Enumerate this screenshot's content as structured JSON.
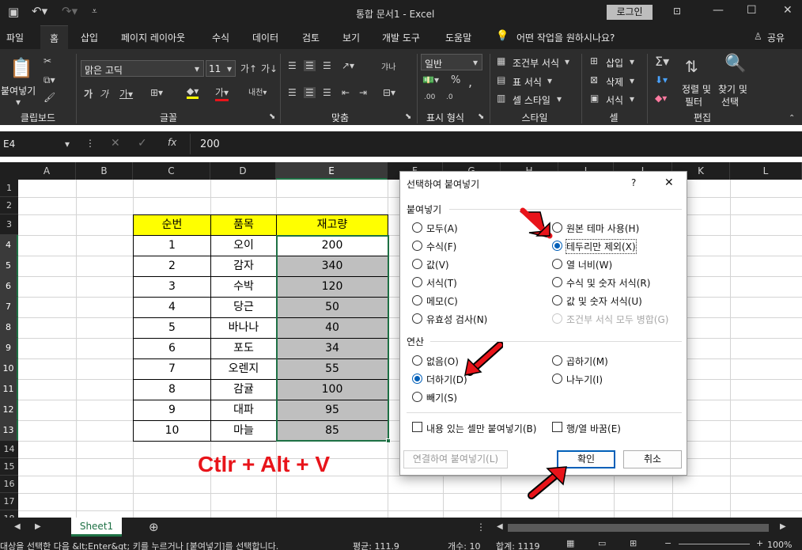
{
  "title": "통합 문서1  -  Excel",
  "login": "로그인",
  "tabs": [
    "파일",
    "홈",
    "삽입",
    "페이지 레이아웃",
    "수식",
    "데이터",
    "검토",
    "보기",
    "개발 도구",
    "도움말"
  ],
  "tellme": "어떤 작업을 원하시나요?",
  "share": "공유",
  "ribbon": {
    "paste": "붙여넣기",
    "font_name": "맑은 고딕",
    "font_size": "11",
    "number_format": "일반",
    "cond_format": "조건부 서식",
    "table_format": "표 서식",
    "cell_style": "셀 스타일",
    "insert": "삽입",
    "delete": "삭제",
    "format": "서식",
    "sort_filter_1": "정렬 및",
    "sort_filter_2": "필터",
    "find_1": "찾기 및",
    "find_2": "선택",
    "groups": [
      "클립보드",
      "글꼴",
      "맞춤",
      "표시 형식",
      "스타일",
      "셀",
      "편집"
    ]
  },
  "namebox": "E4",
  "formula": "200",
  "columns": [
    "A",
    "B",
    "C",
    "D",
    "E",
    "F",
    "G",
    "H",
    "I",
    "J",
    "K",
    "L"
  ],
  "rows": [
    "1",
    "2",
    "3",
    "4",
    "5",
    "6",
    "7",
    "8",
    "9",
    "10",
    "11",
    "12",
    "13",
    "14",
    "15",
    "16",
    "17",
    "18"
  ],
  "table": {
    "headers": [
      "순번",
      "품목",
      "재고량"
    ],
    "rows": [
      [
        "1",
        "오이",
        "200"
      ],
      [
        "2",
        "감자",
        "340"
      ],
      [
        "3",
        "수박",
        "120"
      ],
      [
        "4",
        "당근",
        "50"
      ],
      [
        "5",
        "바나나",
        "40"
      ],
      [
        "6",
        "포도",
        "34"
      ],
      [
        "7",
        "오렌지",
        "55"
      ],
      [
        "8",
        "감귤",
        "100"
      ],
      [
        "9",
        "대파",
        "95"
      ],
      [
        "10",
        "마늘",
        "85"
      ]
    ]
  },
  "shortcut": "Ctlr + Alt + V",
  "dialog": {
    "title": "선택하여 붙여넣기",
    "help": "?",
    "close": "✕",
    "paste_group": "붙여넣기",
    "paste_left": [
      "모두(A)",
      "수식(F)",
      "값(V)",
      "서식(T)",
      "메모(C)",
      "유효성 검사(N)"
    ],
    "paste_right": [
      "원본 테마 사용(H)",
      "테두리만 제외(X)",
      "열 너비(W)",
      "수식 및 숫자 서식(R)",
      "값 및 숫자 서식(U)",
      "조건부 서식 모두 병합(G)"
    ],
    "op_group": "연산",
    "op_left": [
      "없음(O)",
      "더하기(D)",
      "빼기(S)"
    ],
    "op_right": [
      "곱하기(M)",
      "나누기(I)"
    ],
    "skip_blanks": "내용 있는 셀만 붙여넣기(B)",
    "transpose": "행/열 바꿈(E)",
    "paste_link": "연결하여 붙여넣기(L)",
    "ok": "확인",
    "cancel": "취소"
  },
  "sheet_tab": "Sheet1",
  "status": {
    "message": "대상을 선택한 다음 &lt;Enter&gt; 키를 누르거나 [붙여넣기]를 선택합니다.",
    "average": "평균: 111.9",
    "count": "개수: 10",
    "sum": "합계: 1119",
    "zoom": "100%"
  },
  "colors": {
    "header_fill": "#ffff00",
    "value_fill": "#bfbfbf",
    "accent": "#005fb8",
    "annotation": "#e8141a"
  }
}
